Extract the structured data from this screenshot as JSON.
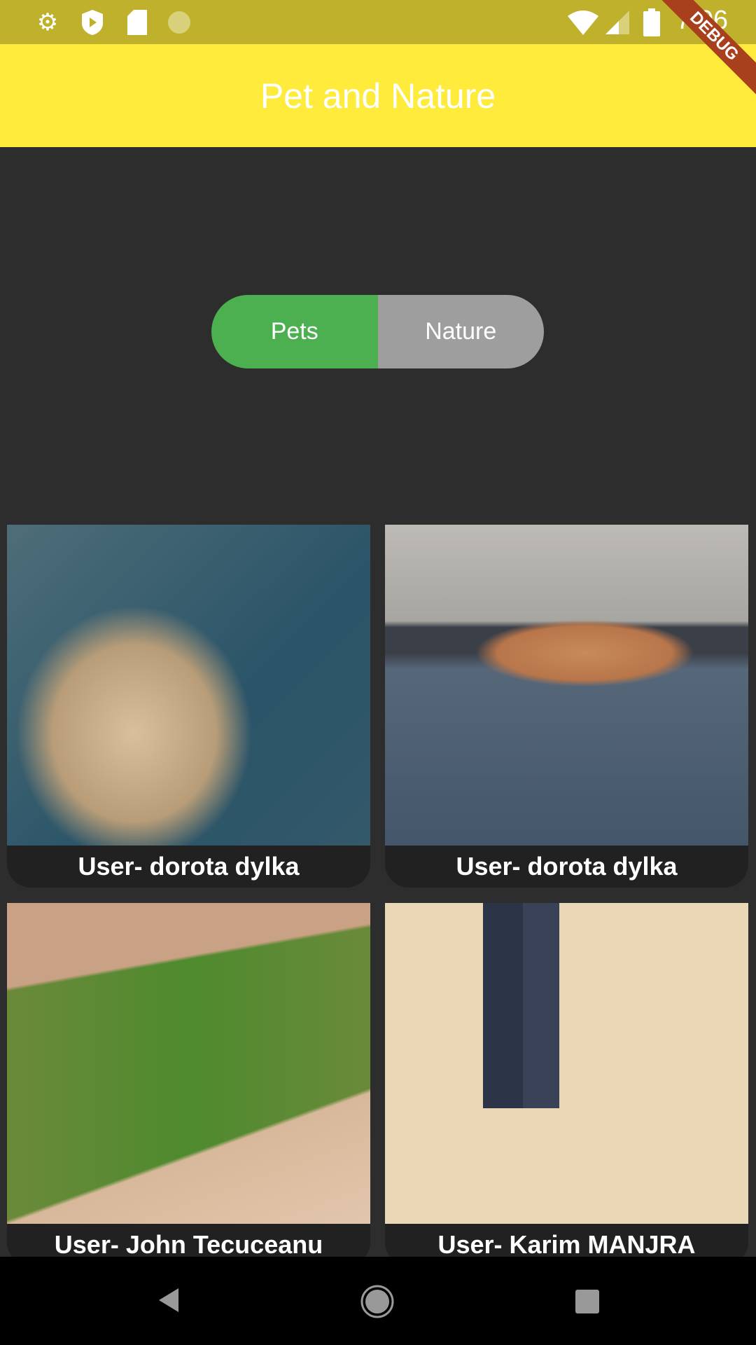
{
  "status_bar": {
    "time": "7:06",
    "icons": [
      "settings-icon",
      "shield-play-icon",
      "sd-card-icon",
      "sync-icon",
      "wifi-icon",
      "signal-icon",
      "battery-icon"
    ]
  },
  "debug_banner": "DEBUG",
  "app_bar": {
    "title": "Pet and Nature"
  },
  "toggle": {
    "options": [
      "Pets",
      "Nature"
    ],
    "selected": "Pets",
    "active_color": "#4caf50",
    "inactive_color": "#9e9e9e"
  },
  "grid": [
    {
      "caption": "User- dorota dylka"
    },
    {
      "caption": "User- dorota dylka"
    },
    {
      "caption": "User- John Tecuceanu"
    },
    {
      "caption": "User- Karim MANJRA"
    }
  ]
}
